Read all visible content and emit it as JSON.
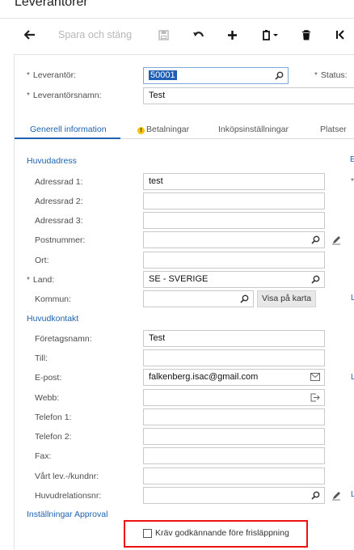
{
  "page": {
    "title": "Leverantörer"
  },
  "toolbar": {
    "back_icon": "arrow-left-icon",
    "save_close_label": "Spara och stäng",
    "save_icon": "save-icon",
    "undo_icon": "undo-icon",
    "add_icon": "plus-icon",
    "copy_icon": "copy-paste-icon",
    "delete_icon": "trash-icon",
    "first_icon": "first-record-icon"
  },
  "header": {
    "vendor_label": "Leverantör:",
    "vendor_value": "50001",
    "status_label": "Status:",
    "vendor_name_label": "Leverantörsnamn:",
    "vendor_name_value": "Test",
    "required_mark": "*"
  },
  "tabs": [
    {
      "label": "Generell information",
      "active": true
    },
    {
      "label": "Betalningar",
      "warning": true
    },
    {
      "label": "Inköpsinställningar"
    },
    {
      "label": "Platser"
    }
  ],
  "main_address": {
    "title": "Huvudadress",
    "address1_label": "Adressrad 1:",
    "address1_value": "test",
    "address2_label": "Adressrad 2:",
    "address2_value": "",
    "address3_label": "Adressrad 3:",
    "address3_value": "",
    "postal_label": "Postnummer:",
    "postal_value": "",
    "city_label": "Ort:",
    "city_value": "",
    "country_label": "Land:",
    "country_value": "SE - SVERIGE",
    "municipality_label": "Kommun:",
    "municipality_value": "",
    "map_button": "Visa på karta"
  },
  "main_contact": {
    "title": "Huvudkontakt",
    "company_label": "Företagsnamn:",
    "company_value": "Test",
    "attention_label": "Till:",
    "attention_value": "",
    "email_label": "E-post:",
    "email_value": "falkenberg.isac@gmail.com",
    "web_label": "Webb:",
    "web_value": "",
    "phone1_label": "Telefon 1:",
    "phone1_value": "",
    "phone2_label": "Telefon 2:",
    "phone2_value": "",
    "fax_label": "Fax:",
    "fax_value": "",
    "account_label": "Vårt lev.-/kundnr:",
    "account_value": "",
    "relation_label": "Huvudrelationsnr:",
    "relation_value": ""
  },
  "approval": {
    "title": "Inställningar Approval",
    "require_label": "Kräv godkännande före frisläppning",
    "require_checked": false
  },
  "right_edge": {
    "mark_b": "E",
    "mark_l": "L"
  },
  "colors": {
    "accent": "#1e62b0",
    "highlight_box": "#ee1111",
    "selection": "#1e5fb5"
  }
}
